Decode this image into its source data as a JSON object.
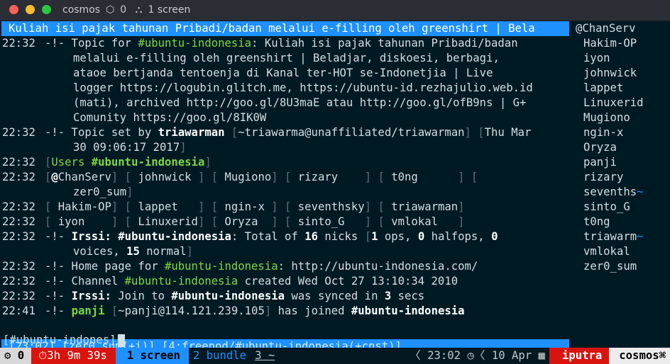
{
  "window": {
    "title": "cosmos",
    "badge_count": "0",
    "screen_label": "1 screen"
  },
  "topic_bar": "Kuliah isi pajak tahunan Pribadi/badan melalui e-filling oleh greenshirt | Bela",
  "lines": [
    {
      "ts": "22:32",
      "parts": [
        {
          "t": "-!- Topic for ",
          "c": ""
        },
        {
          "t": "#ubuntu-indonesia",
          "c": "g"
        },
        {
          "t": ": Kuliah isi pajak tahunan Pribadi/badan",
          "c": ""
        }
      ]
    },
    {
      "ts": "",
      "cont": true,
      "parts": [
        {
          "t": "melalui e-filling oleh greenshirt | Beladjar, diskoesi, berbagi,",
          "c": ""
        }
      ]
    },
    {
      "ts": "",
      "cont": true,
      "parts": [
        {
          "t": "ataoe bertjanda tentoenja di Kanal ter-HOT se-Indonetjia | Live",
          "c": ""
        }
      ]
    },
    {
      "ts": "",
      "cont": true,
      "parts": [
        {
          "t": "logger https://logubin.glitch.me, https://ubuntu-id.rezhajulio.web.id",
          "c": ""
        }
      ]
    },
    {
      "ts": "",
      "cont": true,
      "parts": [
        {
          "t": "(mati), archived http://goo.gl/8U3maE atau http://goo.gl/ofB9ns | G+",
          "c": ""
        }
      ]
    },
    {
      "ts": "",
      "cont": true,
      "parts": [
        {
          "t": "Comunity https://goo.gl/8IK0W",
          "c": ""
        }
      ]
    },
    {
      "ts": "22:32",
      "parts": [
        {
          "t": "-!- Topic set by ",
          "c": ""
        },
        {
          "t": "triawarman",
          "c": "b"
        },
        {
          "t": " [",
          "c": "dim"
        },
        {
          "t": "~triawarma@unaffiliated/triawarman",
          "c": ""
        },
        {
          "t": "] [",
          "c": "dim"
        },
        {
          "t": "Thu Mar",
          "c": ""
        }
      ]
    },
    {
      "ts": "",
      "cont": true,
      "parts": [
        {
          "t": "30 09:06:17 2017",
          "c": ""
        },
        {
          "t": "]",
          "c": "dim"
        }
      ]
    },
    {
      "ts": "22:32",
      "parts": [
        {
          "t": "[",
          "c": "dim"
        },
        {
          "t": "Users ",
          "c": "g"
        },
        {
          "t": "#ubuntu-indonesia",
          "c": "hl"
        },
        {
          "t": "]",
          "c": "dim"
        }
      ]
    },
    {
      "ts": "22:32",
      "parts": [
        {
          "t": "[",
          "c": "dim"
        },
        {
          "t": "@",
          "c": "b"
        },
        {
          "t": "ChanServ",
          "c": ""
        },
        {
          "t": "] [",
          "c": "dim"
        },
        {
          "t": " johnwick ",
          "c": ""
        },
        {
          "t": "] [",
          "c": "dim"
        },
        {
          "t": " Mugiono",
          "c": ""
        },
        {
          "t": "] [",
          "c": "dim"
        },
        {
          "t": " rizary    ",
          "c": ""
        },
        {
          "t": "] [",
          "c": "dim"
        },
        {
          "t": " t0ng      ",
          "c": ""
        },
        {
          "t": "] [",
          "c": "dim"
        }
      ]
    },
    {
      "ts": "",
      "cont": true,
      "parts": [
        {
          "t": "zer0_sum",
          "c": ""
        },
        {
          "t": "]",
          "c": "dim"
        }
      ]
    },
    {
      "ts": "22:32",
      "parts": [
        {
          "t": "[",
          "c": "dim"
        },
        {
          "t": " Hakim-OP",
          "c": ""
        },
        {
          "t": "] [",
          "c": "dim"
        },
        {
          "t": " lappet   ",
          "c": ""
        },
        {
          "t": "] [",
          "c": "dim"
        },
        {
          "t": " ngin-x ",
          "c": ""
        },
        {
          "t": "] [",
          "c": "dim"
        },
        {
          "t": " seventhsky",
          "c": ""
        },
        {
          "t": "] [",
          "c": "dim"
        },
        {
          "t": " triawarman",
          "c": ""
        },
        {
          "t": "]",
          "c": "dim"
        }
      ]
    },
    {
      "ts": "22:32",
      "parts": [
        {
          "t": "[",
          "c": "dim"
        },
        {
          "t": " iyon    ",
          "c": ""
        },
        {
          "t": "] [",
          "c": "dim"
        },
        {
          "t": " Linuxerid",
          "c": ""
        },
        {
          "t": "] [",
          "c": "dim"
        },
        {
          "t": " Oryza  ",
          "c": ""
        },
        {
          "t": "] [",
          "c": "dim"
        },
        {
          "t": " sinto_G   ",
          "c": ""
        },
        {
          "t": "] [",
          "c": "dim"
        },
        {
          "t": " vmlokal   ",
          "c": ""
        },
        {
          "t": "]",
          "c": "dim"
        }
      ]
    },
    {
      "ts": "22:32",
      "parts": [
        {
          "t": "-!- ",
          "c": ""
        },
        {
          "t": "Irssi:",
          "c": "b"
        },
        {
          "t": " ",
          "c": ""
        },
        {
          "t": "#ubuntu-indonesia",
          "c": "b"
        },
        {
          "t": ": Total of ",
          "c": ""
        },
        {
          "t": "16",
          "c": "b"
        },
        {
          "t": " nicks ",
          "c": ""
        },
        {
          "t": "[",
          "c": "dim"
        },
        {
          "t": "1",
          "c": "b"
        },
        {
          "t": " ops, ",
          "c": ""
        },
        {
          "t": "0",
          "c": "b"
        },
        {
          "t": " halfops, ",
          "c": ""
        },
        {
          "t": "0",
          "c": "b"
        }
      ]
    },
    {
      "ts": "",
      "cont": true,
      "parts": [
        {
          "t": "voices, ",
          "c": ""
        },
        {
          "t": "15",
          "c": "b"
        },
        {
          "t": " normal",
          "c": ""
        },
        {
          "t": "]",
          "c": "dim"
        }
      ]
    },
    {
      "ts": "22:32",
      "parts": [
        {
          "t": "-!- Home page for ",
          "c": ""
        },
        {
          "t": "#ubuntu-indonesia",
          "c": "g"
        },
        {
          "t": ": http://ubuntu-indonesia.com/",
          "c": ""
        }
      ]
    },
    {
      "ts": "22:32",
      "parts": [
        {
          "t": "-!- Channel ",
          "c": ""
        },
        {
          "t": "#ubuntu-indonesia",
          "c": "g"
        },
        {
          "t": " created Wed Oct 27 13:10:34 2010",
          "c": ""
        }
      ]
    },
    {
      "ts": "22:32",
      "parts": [
        {
          "t": "-!- ",
          "c": ""
        },
        {
          "t": "Irssi:",
          "c": "b"
        },
        {
          "t": " Join to ",
          "c": ""
        },
        {
          "t": "#ubuntu-indonesia",
          "c": "b"
        },
        {
          "t": " was synced in ",
          "c": ""
        },
        {
          "t": "3",
          "c": "b"
        },
        {
          "t": " secs",
          "c": ""
        }
      ]
    },
    {
      "ts": "22:41",
      "parts": [
        {
          "t": "-!- ",
          "c": ""
        },
        {
          "t": "panji",
          "c": "hl"
        },
        {
          "t": " [",
          "c": "dim"
        },
        {
          "t": "~panji@114.121.239.105",
          "c": ""
        },
        {
          "t": "]",
          "c": "dim"
        },
        {
          "t": " has joined ",
          "c": ""
        },
        {
          "t": "#ubuntu-indonesia",
          "c": "b"
        }
      ]
    }
  ],
  "nicks": [
    "@ChanServ",
    "Hakim-OP",
    "iyon",
    "johnwick",
    "lappet",
    "Linuxerid",
    "Mugiono",
    "ngin-x",
    "Oryza",
    "panji",
    "rizary",
    "sevenths~",
    "sinto_G",
    "t0ng",
    "triawarm~",
    "vmlokal",
    "zer0_sum"
  ],
  "statusbar": "[23:02] [zer0_sum(+i)] [4:freenod/#ubuntu-indonesia(+cnst)]",
  "prompt": "[#ubuntu-indones]",
  "tmux": {
    "session": "0",
    "timer": "3h 9m 39s",
    "window_active": "1 screen",
    "window_2": "2 bundle",
    "window_3": "3 ~",
    "time": "23:02",
    "date": "10 Apr",
    "user": "iputra",
    "host": "cosmos⌘"
  },
  "colors": {
    "accent": "#1e90ff",
    "alert": "#d9140f",
    "channel": "#7fd83e",
    "background": "#001a24"
  }
}
